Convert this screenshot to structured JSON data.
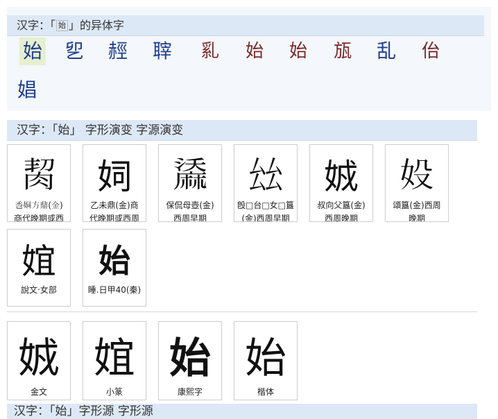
{
  "variants_section": {
    "header": {
      "prefix": "汉字：「",
      "char": "始",
      "suffix": "」的异体字"
    },
    "chars": [
      "始",
      "乮",
      "䞓",
      "䏁",
      "乿",
      "始",
      "始",
      "瓬",
      "乱",
      "佁",
      "娼"
    ]
  },
  "evolution_section": {
    "header": "汉字：「始」 字形演变 字源演变",
    "items": [
      {
        "glyph": "𦚨",
        "caption": [
          "𢀷姛方鼎(金)",
          "商代晚期或西"
        ]
      },
      {
        "glyph": "㚸",
        "caption": [
          "乙未鼎(金)商",
          "代晚期或西周"
        ]
      },
      {
        "glyph": "𪎤",
        "caption": [
          "保侃母壺(金)",
          "西周早期"
        ]
      },
      {
        "glyph": "𠫬",
        "caption": [
          "𣪘□台□女□簋",
          "(金)西周早期"
        ]
      },
      {
        "glyph": "𡜐",
        "caption": [
          "叔向父簋(金)",
          "西周晚期"
        ]
      },
      {
        "glyph": "𡚾",
        "caption": [
          "頌簋(金)西周",
          "晚期"
        ]
      },
      {
        "glyph": "𡝮",
        "caption": [
          "說文‧女部"
        ]
      },
      {
        "glyph": "始",
        "caption": [
          "睡.日甲40(秦)"
        ]
      }
    ],
    "standard": [
      {
        "glyph": "𡜐",
        "caption": "金文"
      },
      {
        "glyph": "𡝮",
        "caption": "小篆"
      },
      {
        "glyph": "始",
        "caption": "康熙字"
      },
      {
        "glyph": "始",
        "caption": "楷体"
      }
    ],
    "next_header": "汉字：「始」字形源 字形源"
  }
}
